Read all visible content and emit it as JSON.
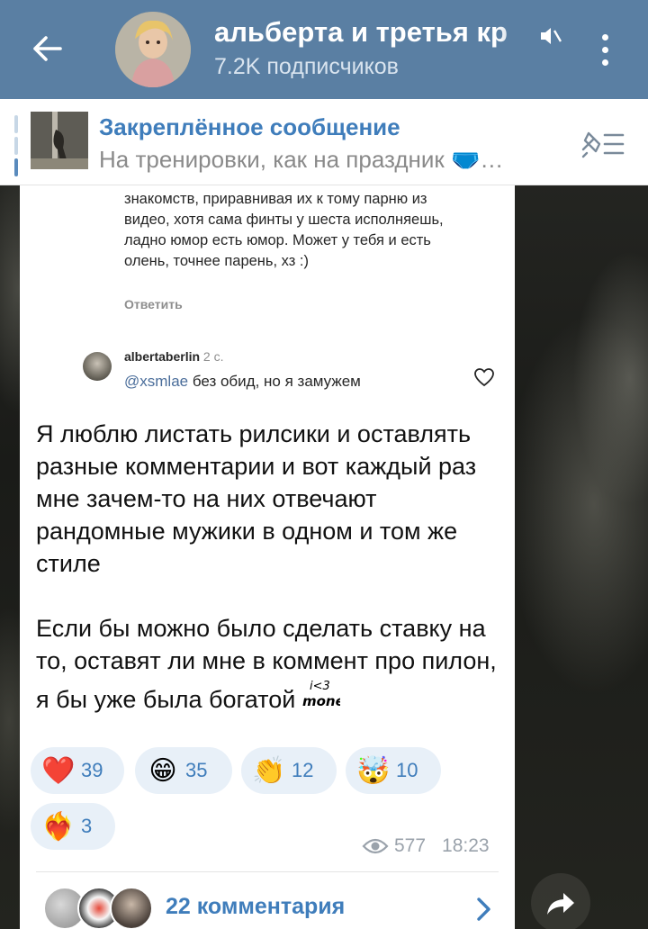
{
  "header": {
    "title": "альберта и третья кр",
    "subscribers": "7.2K подписчиков"
  },
  "pinned": {
    "title": "Закреплённое сообщение",
    "text": "На тренировки, как на праздник 🩲…"
  },
  "screenshot": {
    "text": "знакомств, приравнивая их к тому парню из видео, хотя сама финты у шеста исполняешь, ладно юмор есть юмор. Может у тебя и есть олень, точнее парень, хз :)",
    "reply_label": "Ответить",
    "username": "albertaberlin",
    "time_ago": "2 с.",
    "mention": "@xsmlae",
    "comment": " без обид, но я замужем"
  },
  "message": {
    "paragraph1": "Я люблю листать рилсики и оставлять разные комментарии и вот каждый раз мне зачем-то на них отвечают рандомные мужики в одном и том же стиле",
    "paragraph2": "Если бы можно было сделать ставку на то, оставят ли мне в коммент про пилон, я бы уже была богатой"
  },
  "reactions": [
    {
      "emoji": "❤️",
      "icon": "heart-icon",
      "count": "39"
    },
    {
      "emoji": "😁",
      "icon": "grin-icon",
      "count": "35"
    },
    {
      "emoji": "👏",
      "icon": "clap-icon",
      "count": "12"
    },
    {
      "emoji": "🤯",
      "icon": "mind-blown-icon",
      "count": "10"
    },
    {
      "emoji": "❤️‍🔥",
      "icon": "heart-on-fire-icon",
      "count": "3"
    }
  ],
  "meta": {
    "views": "577",
    "time": "18:23"
  },
  "comments": {
    "label": "22 комментария"
  },
  "colors": {
    "header_bg": "#5a7fa3",
    "accent": "#3f7dbb",
    "reaction_bg": "#e8f0f8"
  }
}
